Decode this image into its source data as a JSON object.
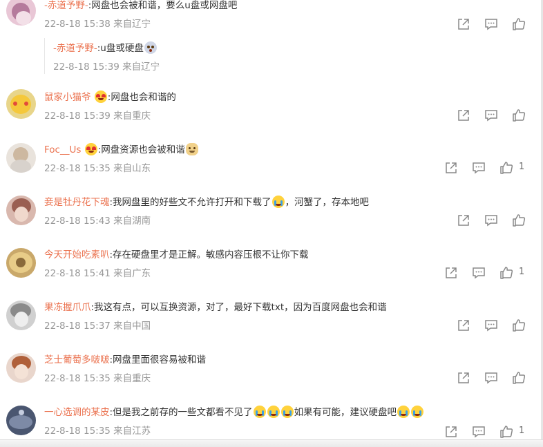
{
  "comments": [
    {
      "user": "-赤道予野-",
      "text": ":网盘也会被和谐，要么u盘或网盘吧",
      "time": "22-8-18 15:38 来自辽宁",
      "likes": "",
      "reply": {
        "user": "-赤道予野-",
        "text": ":u盘或硬盘",
        "time": "22-8-18 15:39 来自辽宁"
      }
    },
    {
      "user": "鼠家小猫爷",
      "text": ":网盘也会和谐的",
      "time": "22-8-18 15:39 来自重庆",
      "likes": ""
    },
    {
      "user": "Foc__Us",
      "text": ":网盘资源也会被和谐",
      "time": "22-8-18 15:35 来自山东",
      "likes": "1"
    },
    {
      "user": "妾是牡丹花下魂",
      "text": ":我网盘里的好些文不允许打开和下载了",
      "text2": "，河蟹了，存本地吧",
      "time": "22-8-18 15:43 来自湖南",
      "likes": ""
    },
    {
      "user": "今天开始吃素叭",
      "text": ":存在硬盘里才是正解。敏感内容压根不让你下载",
      "time": "22-8-18 15:41 来自广东",
      "likes": "1"
    },
    {
      "user": "果冻握爪爪",
      "text": ":我这有点，可以互换资源，对了，最好下载txt，因为百度网盘也会和谐",
      "time": "22-8-18 15:37 来自中国",
      "likes": ""
    },
    {
      "user": "芝士葡萄多啵啵",
      "text": ":网盘里面很容易被和谐",
      "time": "22-8-18 15:35 来自重庆",
      "likes": ""
    },
    {
      "user": "一心选调的某皮",
      "text": ":但是我之前存的一些文都看不见了",
      "text2": "如果有可能，建议硬盘吧",
      "time": "22-8-18 15:35 来自江苏",
      "likes": "1"
    }
  ],
  "icons": {
    "share": "share-icon",
    "comment": "comment-icon",
    "like": "thumbs-up-icon",
    "emoji_heart": "heart-eyes-emoji-icon",
    "emoji_cry": "crying-emoji-icon",
    "emoji_doge": "doge-emoji-icon",
    "emoji_shock": "shocked-emoji-icon"
  },
  "colors": {
    "username": "#eb7350",
    "text": "#333333",
    "meta": "#999999",
    "icon": "#888888"
  }
}
